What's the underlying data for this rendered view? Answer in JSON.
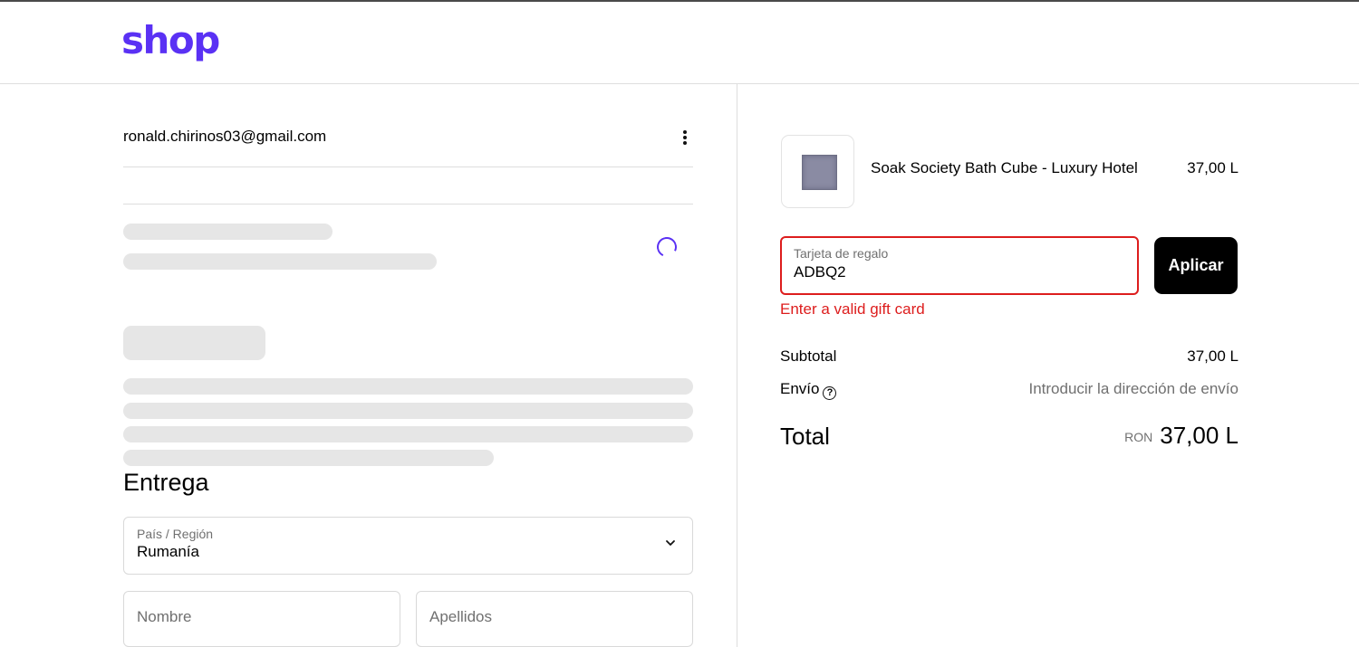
{
  "brand": {
    "logo_text": "shop",
    "color": "#5a31f4"
  },
  "account": {
    "email": "ronald.chirinos03@gmail.com",
    "menu_icon": "kebab-menu-icon"
  },
  "delivery": {
    "heading": "Entrega",
    "country_label": "País / Región",
    "country_value": "Rumanía",
    "first_name_placeholder": "Nombre",
    "last_name_placeholder": "Apellidos"
  },
  "order": {
    "item": {
      "name": "Soak Society Bath Cube - Luxury Hotel",
      "price": "37,00 L"
    },
    "gift_card": {
      "label": "Tarjeta de regalo",
      "value": "ADBQ2",
      "apply_label": "Aplicar",
      "error": "Enter a valid gift card",
      "error_color": "#dd1d1d"
    },
    "subtotal_label": "Subtotal",
    "subtotal_value": "37,00 L",
    "shipping_label": "Envío",
    "shipping_help_icon": "question-circle-icon",
    "shipping_value": "Introducir la dirección de envío",
    "total_label": "Total",
    "currency": "RON",
    "total_value": "37,00 L"
  }
}
